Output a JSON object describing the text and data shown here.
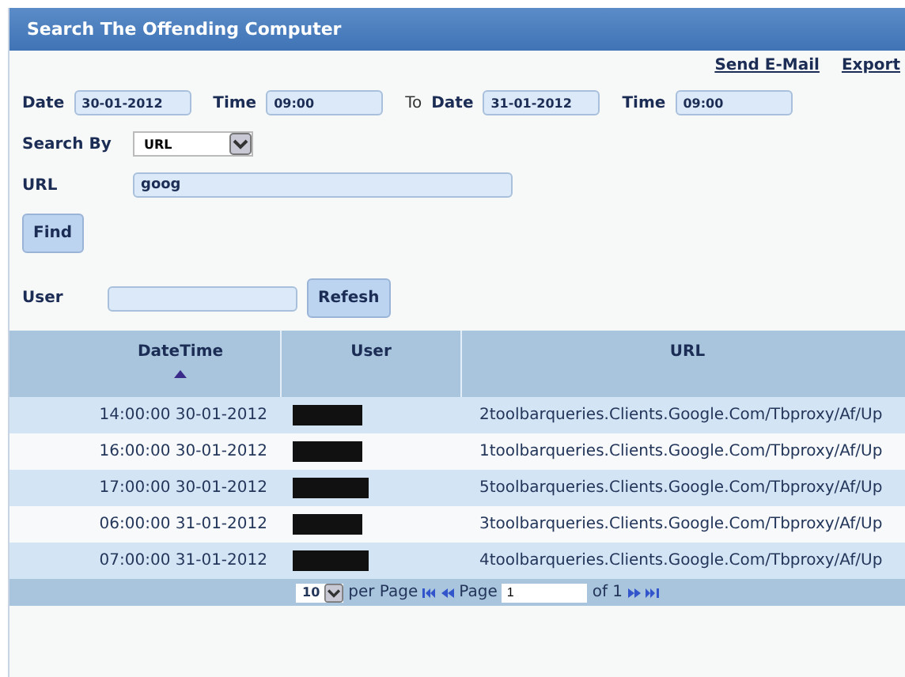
{
  "window": {
    "title": "Search The Offending Computer"
  },
  "links": [
    "Send E-Mail",
    "Export"
  ],
  "date_range": {
    "from_label": "Date",
    "from_date": "30-01-2012",
    "from_time_label": "Time",
    "from_time": "09:00",
    "to": "To",
    "to_label": "Date",
    "to_date": "31-01-2012",
    "to_time_label": "Time",
    "to_time": "09:00"
  },
  "search_by": {
    "label": "Search By",
    "value": "URL"
  },
  "url": {
    "label": "URL",
    "value": "goog"
  },
  "find_button": "Find",
  "user": {
    "label": "User",
    "button": "Refesh"
  },
  "table": {
    "columns": [
      {
        "label": "DateTime",
        "sorted": true
      },
      {
        "label": "User",
        "sorted": false
      },
      {
        "label": "URL",
        "sorted": false
      }
    ],
    "rows": [
      {
        "datetime": "14:00:00 30-01-2012",
        "url": "2toolbarqueries.Clients.Google.Com/Tbproxy/Af/Up"
      },
      {
        "datetime": "16:00:00 30-01-2012",
        "url": "1toolbarqueries.Clients.Google.Com/Tbproxy/Af/Up"
      },
      {
        "datetime": "17:00:00 30-01-2012",
        "url": "5toolbarqueries.Clients.Google.Com/Tbproxy/Af/Up"
      },
      {
        "datetime": "06:00:00 31-01-2012",
        "url": "3toolbarqueries.Clients.Google.Com/Tbproxy/Af/Up"
      },
      {
        "datetime": "07:00:00 31-01-2012",
        "url": "4toolbarqueries.Clients.Google.Com/Tbproxy/Af/Up"
      }
    ]
  },
  "pager": {
    "page_size": "10",
    "per_page": "per Page",
    "page_label": "Page",
    "page": "1",
    "of": "of 1"
  }
}
